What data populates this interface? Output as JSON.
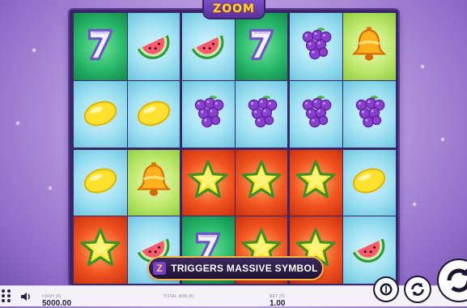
{
  "game": {
    "logo_text": "ZOOM",
    "banner": {
      "badge": "Z",
      "text": "TRIGGERS MASSIVE SYMBOL"
    }
  },
  "reels": [
    [
      "seven",
      "watermelon",
      "watermelon",
      "seven",
      "grapes",
      "bell"
    ],
    [
      "lemon",
      "lemon",
      "grapes",
      "grapes",
      "grapes",
      "grapes"
    ],
    [
      "lemon",
      "bell",
      "star",
      "star",
      "star",
      "lemon"
    ],
    [
      "star",
      "watermelon",
      "seven",
      "star",
      "star",
      "watermelon"
    ]
  ],
  "cell_backgrounds": [
    [
      "green",
      "blue",
      "blue",
      "green",
      "blue",
      "lime"
    ],
    [
      "blue",
      "blue",
      "blue",
      "blue",
      "blue",
      "blue"
    ],
    [
      "blue",
      "lime",
      "red",
      "red",
      "red",
      "blue"
    ],
    [
      "red",
      "blue",
      "green",
      "red",
      "red",
      "blue"
    ]
  ],
  "footer": {
    "cash_label": "CASH (€)",
    "cash_value": "5000.00",
    "total_win_label": "TOTAL WIN (€)",
    "total_win_value": "",
    "bet_label": "BET (€)",
    "bet_value": "1.00"
  },
  "icons": {
    "menu": "menu-dots-icon",
    "sound": "speaker-icon",
    "bet": "coin-stack-icon",
    "autoplay": "autoplay-icon",
    "spin": "spin-icon"
  }
}
